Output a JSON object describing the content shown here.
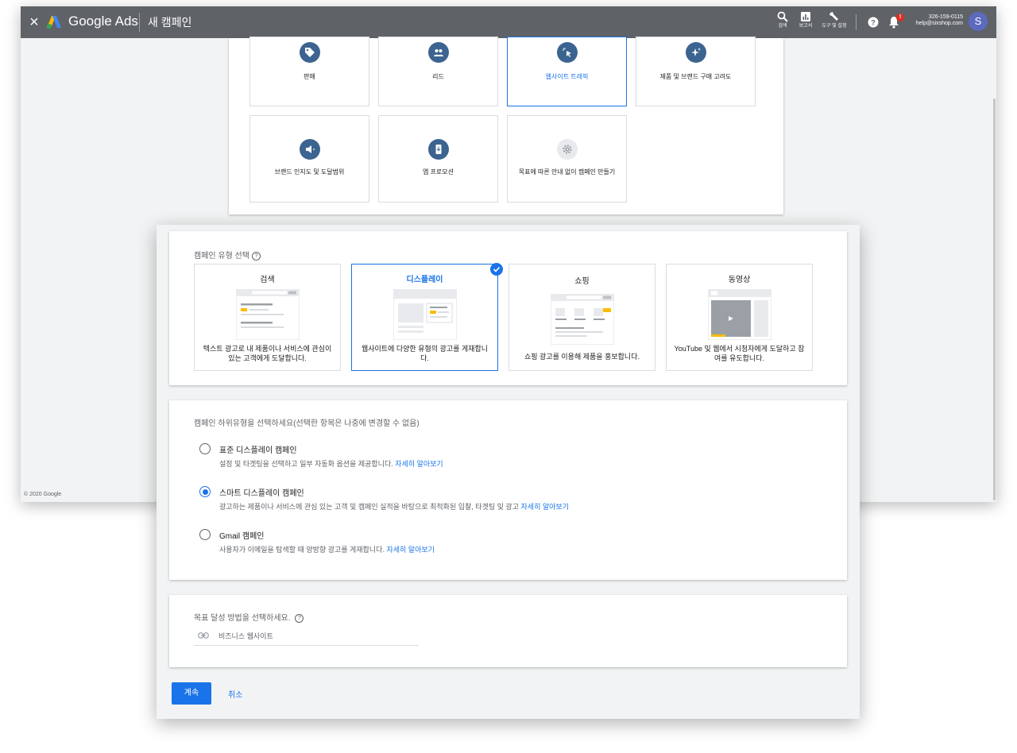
{
  "topbar": {
    "brand": "Google Ads",
    "title": "새 캠페인",
    "tools": [
      {
        "label": "검색",
        "icon": "search-icon"
      },
      {
        "label": "보고서",
        "icon": "reports-icon"
      },
      {
        "label": "도구 및 설정",
        "icon": "wrench-icon"
      }
    ],
    "notification_badge": "!",
    "account_id": "326-159-0115",
    "account_email": "help@sixshop.com",
    "avatar_letter": "S"
  },
  "goals": [
    {
      "label": "판매",
      "icon": "tag-icon",
      "selected": false
    },
    {
      "label": "리드",
      "icon": "people-icon",
      "selected": false
    },
    {
      "label": "웹사이트 트래픽",
      "icon": "cursor-click-icon",
      "selected": true
    },
    {
      "label": "제품 및 브랜드 구매 고려도",
      "icon": "sparkle-icon",
      "selected": false
    },
    {
      "label": "브랜드 인지도 및 도달범위",
      "icon": "speaker-icon",
      "selected": false
    },
    {
      "label": "앱 프로모션",
      "icon": "phone-download-icon",
      "selected": false
    },
    {
      "label": "목표에 따른 안내 없이 캠페인 만들기",
      "icon": "gear-icon",
      "selected": false
    }
  ],
  "copyright": "© 2020 Google",
  "campaign_type": {
    "title": "캠페인 유형 선택",
    "cards": [
      {
        "name": "검색",
        "desc": "텍스트 광고로 내 제품이나 서비스에 관심이 있는 고객에게 도달합니다.",
        "selected": false
      },
      {
        "name": "디스플레이",
        "desc": "웹사이트에 다양한 유형의 광고를 게재합니다.",
        "selected": true
      },
      {
        "name": "쇼핑",
        "desc": "쇼핑 광고를 이용해 제품을 홍보합니다.",
        "selected": false
      },
      {
        "name": "동영상",
        "desc": "YouTube 및 웹에서 시청자에게 도달하고 참여를 유도합니다.",
        "selected": false
      }
    ]
  },
  "subtype": {
    "title": "캠페인 하위유형을 선택하세요(선택한 항목은 나중에 변경할 수 없음)",
    "options": [
      {
        "title": "표준 디스플레이 캠페인",
        "desc": "설정 및 타겟팅을 선택하고 일부 자동화 옵션을 제공합니다.",
        "link": "자세히 알아보기",
        "selected": false
      },
      {
        "title": "스마트 디스플레이 캠페인",
        "desc": "광고하는 제품이나 서비스에 관심 있는 고객 및 캠페인 실적을 바탕으로 최적화된 입찰, 타겟팅 및 광고",
        "link": "자세히 알아보기",
        "selected": true
      },
      {
        "title": "Gmail 캠페인",
        "desc": "사용자가 이메일을 탐색할 때 양방향 광고를 게재합니다.",
        "link": "자세히 알아보기",
        "selected": false
      }
    ]
  },
  "goal_method": {
    "title": "목표 달성 방법을 선택하세요.",
    "field_placeholder": "비즈니스 웹사이트"
  },
  "actions": {
    "continue_label": "계속",
    "cancel_label": "취소"
  },
  "colors": {
    "topbar": "#5f6368",
    "accent": "#1a73e8",
    "goal_icon": "#3c6490",
    "illustration_accent": "#fbbc04"
  }
}
